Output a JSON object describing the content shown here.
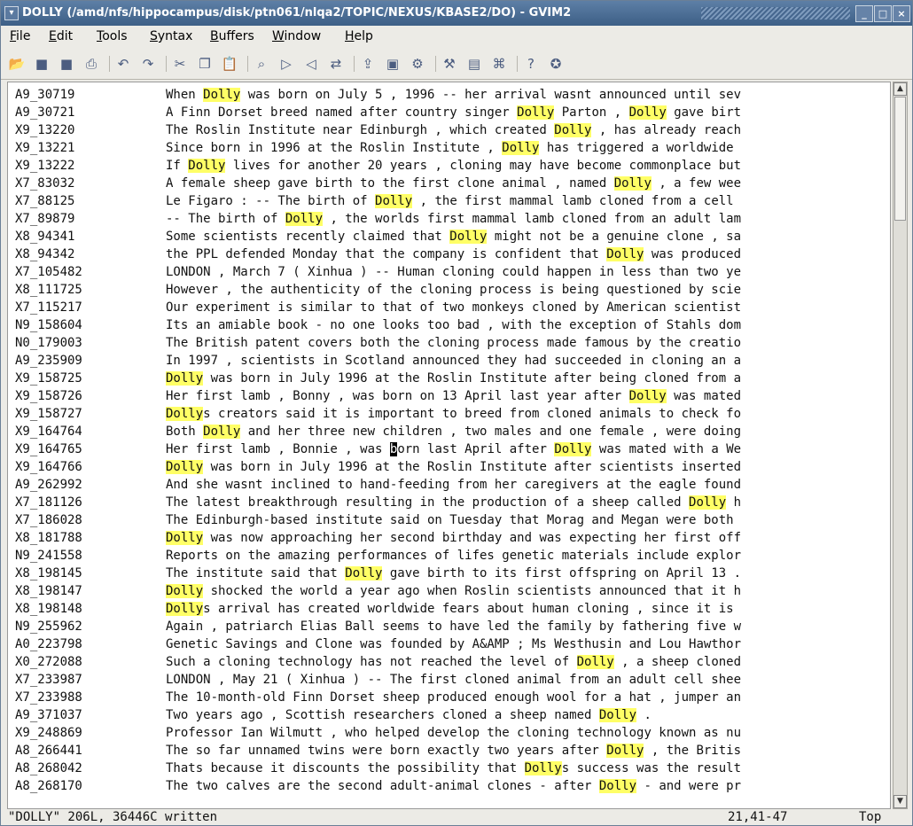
{
  "window": {
    "title": "DOLLY (/amd/nfs/hippocampus/disk/ptn061/nlqa2/TOPIC/NEXUS/KBASE2/DO) - GVIM2",
    "controls": [
      "_",
      "□",
      "×"
    ]
  },
  "menubar": {
    "items": [
      {
        "label": "File"
      },
      {
        "label": "Edit"
      },
      {
        "label": "Tools"
      },
      {
        "label": "Syntax"
      },
      {
        "label": "Buffers"
      },
      {
        "label": "Window"
      },
      {
        "label": "Help"
      }
    ]
  },
  "toolbar": {
    "tools": [
      "open-icon",
      "save-icon",
      "save-all-icon",
      "print-icon",
      "sep",
      "undo-icon",
      "redo-icon",
      "sep",
      "cut-icon",
      "copy-icon",
      "paste-icon",
      "sep",
      "find-icon",
      "find-next-icon",
      "find-prev-icon",
      "replace-icon",
      "sep",
      "load-session-icon",
      "save-session-icon",
      "run-script-icon",
      "sep",
      "make-icon",
      "shell-icon",
      "ctags-icon",
      "sep",
      "help-icon",
      "find-help-icon"
    ],
    "glyphs": {
      "open-icon": "📂",
      "save-icon": "■",
      "save-all-icon": "■",
      "print-icon": "⎙",
      "undo-icon": "↶",
      "redo-icon": "↷",
      "cut-icon": "✂",
      "copy-icon": "❐",
      "paste-icon": "📋",
      "find-icon": "⌕",
      "find-next-icon": "▷",
      "find-prev-icon": "◁",
      "replace-icon": "⇄",
      "load-session-icon": "⇪",
      "save-session-icon": "▣",
      "run-script-icon": "⚙",
      "make-icon": "⚒",
      "shell-icon": "▤",
      "ctags-icon": "⌘",
      "help-icon": "?",
      "find-help-icon": "✪"
    }
  },
  "editor": {
    "highlight_word": "Dolly",
    "cursor": {
      "line": 21,
      "col": 41
    },
    "lines": [
      {
        "id": "A9_30719",
        "text": "When Dolly was born on July 5 , 1996 -- her arrival wasnt announced until sev"
      },
      {
        "id": "A9_30721",
        "text": "A Finn Dorset breed named after country singer Dolly Parton , Dolly gave birt"
      },
      {
        "id": "X9_13220",
        "text": "The Roslin Institute near Edinburgh , which created Dolly , has already reach"
      },
      {
        "id": "X9_13221",
        "text": "Since born in 1996 at the Roslin Institute , Dolly has triggered a worldwide "
      },
      {
        "id": "X9_13222",
        "text": "If Dolly lives for another 20 years , cloning may have become commonplace but"
      },
      {
        "id": "X7_83032",
        "text": "A female sheep gave birth to the first clone animal , named Dolly , a few wee"
      },
      {
        "id": "X7_88125",
        "text": "Le Figaro : -- The birth of Dolly , the first mammal lamb cloned from a cell "
      },
      {
        "id": "X7_89879",
        "text": "-- The birth of Dolly , the worlds first mammal lamb cloned from an adult lam"
      },
      {
        "id": "X8_94341",
        "text": "Some scientists recently claimed that Dolly might not be a genuine clone , sa"
      },
      {
        "id": "X8_94342",
        "text": "the PPL defended Monday that the company is confident that Dolly was produced"
      },
      {
        "id": "X7_105482",
        "text": "LONDON , March 7 ( Xinhua ) -- Human cloning could happen in less than two ye"
      },
      {
        "id": "X8_111725",
        "text": "However , the authenticity of the cloning process is being questioned by scie"
      },
      {
        "id": "X7_115217",
        "text": "Our experiment is similar to that of two monkeys cloned by American scientist"
      },
      {
        "id": "N9_158604",
        "text": "Its an amiable book - no one looks too bad , with the exception of Stahls dom"
      },
      {
        "id": "N0_179003",
        "text": "The British patent covers both the cloning process made famous by the creatio"
      },
      {
        "id": "A9_235909",
        "text": "In 1997 , scientists in Scotland announced they had succeeded in cloning an a"
      },
      {
        "id": "X9_158725",
        "text": "Dolly was born in July 1996 at the Roslin Institute after being cloned from a"
      },
      {
        "id": "X9_158726",
        "text": "Her first lamb , Bonny , was born on 13 April last year after Dolly was mated"
      },
      {
        "id": "X9_158727",
        "text": "Dollys creators said it is important to breed from cloned animals to check fo"
      },
      {
        "id": "X9_164764",
        "text": "Both Dolly and her three new children , two males and one female , were doing"
      },
      {
        "id": "X9_164765",
        "text": "Her first lamb , Bonnie , was born last April after Dolly was mated with a We"
      },
      {
        "id": "X9_164766",
        "text": "Dolly was born in July 1996 at the Roslin Institute after scientists inserted"
      },
      {
        "id": "A9_262992",
        "text": "And she wasnt inclined to hand-feeding from her caregivers at the eagle found"
      },
      {
        "id": "X7_181126",
        "text": "The latest breakthrough resulting in the production of a sheep called Dolly h"
      },
      {
        "id": "X7_186028",
        "text": "The Edinburgh-based institute said on Tuesday that Morag and Megan were both "
      },
      {
        "id": "X8_181788",
        "text": "Dolly was now approaching her second birthday and was expecting her first off"
      },
      {
        "id": "N9_241558",
        "text": "Reports on the amazing performances of lifes genetic materials include explor"
      },
      {
        "id": "X8_198145",
        "text": "The institute said that Dolly gave birth to its first offspring on April 13 ."
      },
      {
        "id": "X8_198147",
        "text": "Dolly shocked the world a year ago when Roslin scientists announced that it h"
      },
      {
        "id": "X8_198148",
        "text": "Dollys arrival has created worldwide fears about human cloning , since it is "
      },
      {
        "id": "N9_255962",
        "text": "Again , patriarch Elias Ball seems to have led the family by fathering five w"
      },
      {
        "id": "A0_223798",
        "text": "Genetic Savings and Clone was founded by A&AMP ; Ms Westhusin and Lou Hawthor"
      },
      {
        "id": "X0_272088",
        "text": "Such a cloning technology has not reached the level of Dolly , a sheep cloned"
      },
      {
        "id": "X7_233987",
        "text": "LONDON , May 21 ( Xinhua ) -- The first cloned animal from an adult cell shee"
      },
      {
        "id": "X7_233988",
        "text": "The 10-month-old Finn Dorset sheep produced enough wool for a hat , jumper an"
      },
      {
        "id": "A9_371037",
        "text": "Two years ago , Scottish researchers cloned a sheep named Dolly ."
      },
      {
        "id": "X9_248869",
        "text": "Professor Ian Wilmutt , who helped develop the cloning technology known as nu"
      },
      {
        "id": "A8_266441",
        "text": "The so far unnamed twins were born exactly two years after Dolly , the Britis"
      },
      {
        "id": "A8_268042",
        "text": "Thats because it discounts the possibility that Dollys success was the result"
      },
      {
        "id": "A8_268170",
        "text": "The two calves are the second adult-animal clones - after Dolly - and were pr"
      }
    ]
  },
  "statusbar": {
    "message": "\"DOLLY\" 206L, 36446C written",
    "position": "21,41-47",
    "scroll": "Top"
  },
  "colors": {
    "highlight": "#ffff66",
    "titlebar": "#4d6f96"
  }
}
